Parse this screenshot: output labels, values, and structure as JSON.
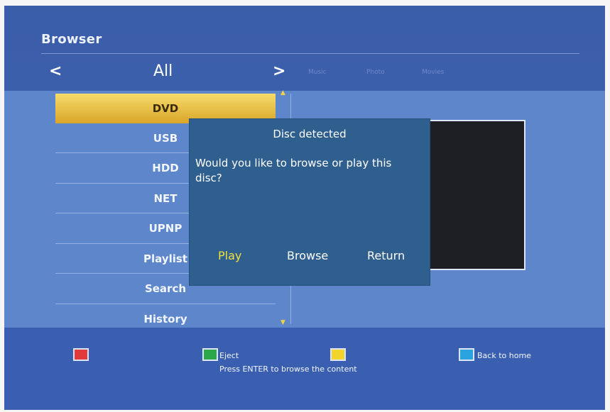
{
  "header": {
    "title": "Browser",
    "nav_prev_symbol": "<",
    "nav_current": "All",
    "nav_next_symbol": ">",
    "category_tabs": [
      "Music",
      "Photo",
      "Movies"
    ]
  },
  "menu": {
    "items": [
      "DVD",
      "USB",
      "HDD",
      "NET",
      "UPNP",
      "Playlist",
      "Search",
      "History"
    ],
    "selected_index": 0
  },
  "dialog": {
    "title": "Disc detected",
    "message": "Would you like to browse or play this disc?",
    "buttons": {
      "play": "Play",
      "browse": "Browse",
      "return": "Return"
    },
    "focused_button": "Play"
  },
  "footer": {
    "green_label": "Eject",
    "hint": "Press ENTER to browse the content",
    "blue_label": "Back to home"
  },
  "colors": {
    "background": "#4467b8",
    "selected_item": "#e9c04a",
    "dialog_bg": "#2f5f8f",
    "focused_button_text": "#f3e13c",
    "key_red": "#e23a3a",
    "key_green": "#2aa84a",
    "key_yellow": "#f1d52c",
    "key_blue": "#2aa4e0"
  }
}
